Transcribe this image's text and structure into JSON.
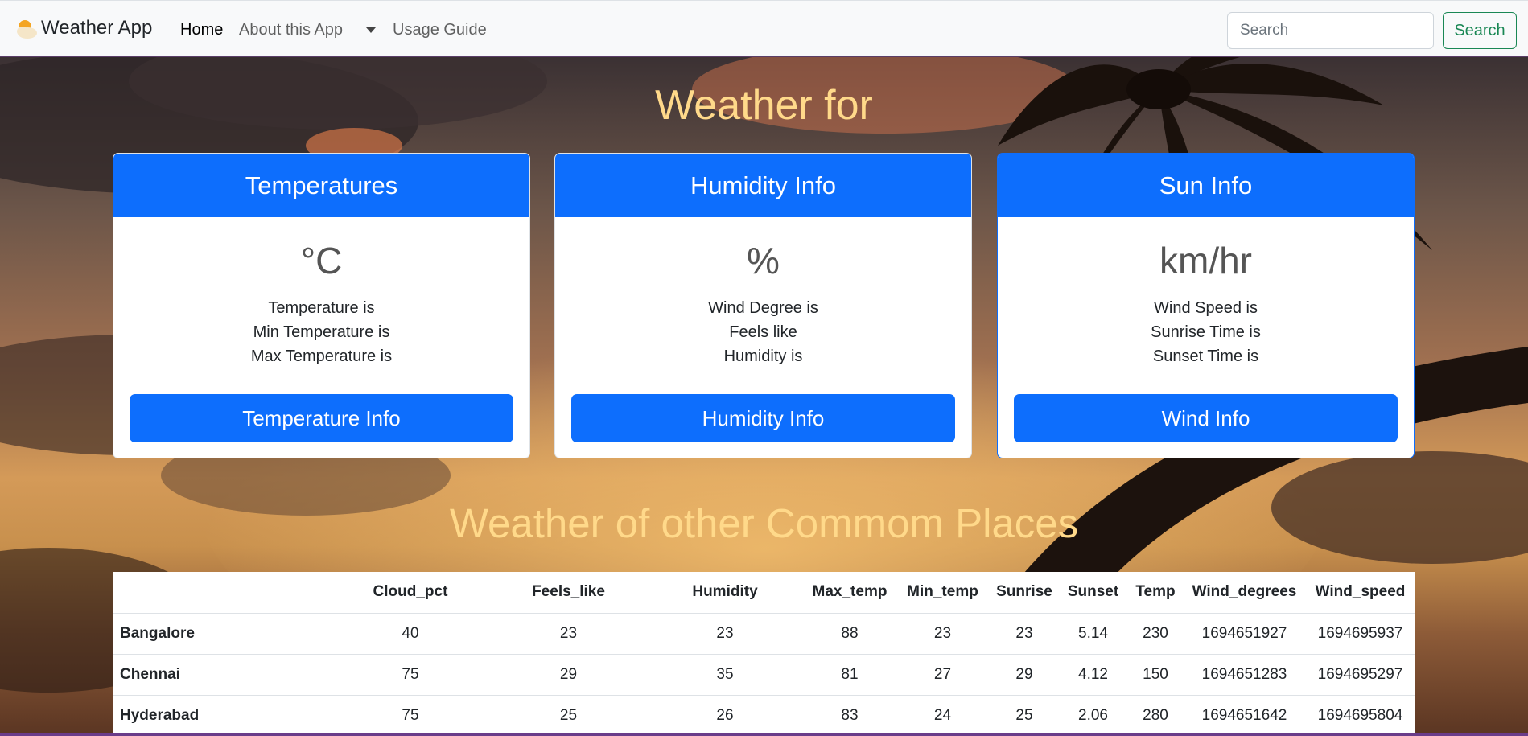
{
  "navbar": {
    "brand": "Weather App",
    "links": [
      "Home",
      "About this App",
      "Usage Guide"
    ],
    "search_placeholder": "Search",
    "search_button": "Search"
  },
  "main": {
    "title": "Weather for",
    "cards": [
      {
        "header": "Temperatures",
        "unit": "°C",
        "lines": [
          "Temperature is",
          "Min Temperature is",
          "Max Temperature is"
        ],
        "button": "Temperature Info"
      },
      {
        "header": "Humidity Info",
        "unit": "%",
        "lines": [
          "Wind Degree is",
          "Feels like",
          "Humidity is"
        ],
        "button": "Humidity Info"
      },
      {
        "header": "Sun Info",
        "unit": "km/hr",
        "lines": [
          "Wind Speed is",
          "Sunrise Time is",
          "Sunset Time is"
        ],
        "button": "Wind Info"
      }
    ],
    "other_places_title": "Weather of other Commom Places"
  },
  "table": {
    "headers": [
      "",
      "Cloud_pct",
      "Feels_like",
      "Humidity",
      "Max_temp",
      "Min_temp",
      "Sunrise",
      "Sunset",
      "Temp",
      "Wind_degrees",
      "Wind_speed"
    ],
    "rows": [
      [
        "Bangalore",
        "40",
        "23",
        "23",
        "88",
        "23",
        "23",
        "5.14",
        "230",
        "1694651927",
        "1694695937"
      ],
      [
        "Chennai",
        "75",
        "29",
        "35",
        "81",
        "27",
        "29",
        "4.12",
        "150",
        "1694651283",
        "1694695297"
      ],
      [
        "Hyderabad",
        "75",
        "25",
        "26",
        "83",
        "24",
        "25",
        "2.06",
        "280",
        "1694651642",
        "1694695804"
      ]
    ]
  },
  "colors": {
    "primary": "#0d6efd",
    "success": "#198754",
    "heading": "#ffd98a"
  },
  "icons": {
    "brand": "sun-cloud-icon",
    "dropdown": "chevron-down-icon"
  }
}
